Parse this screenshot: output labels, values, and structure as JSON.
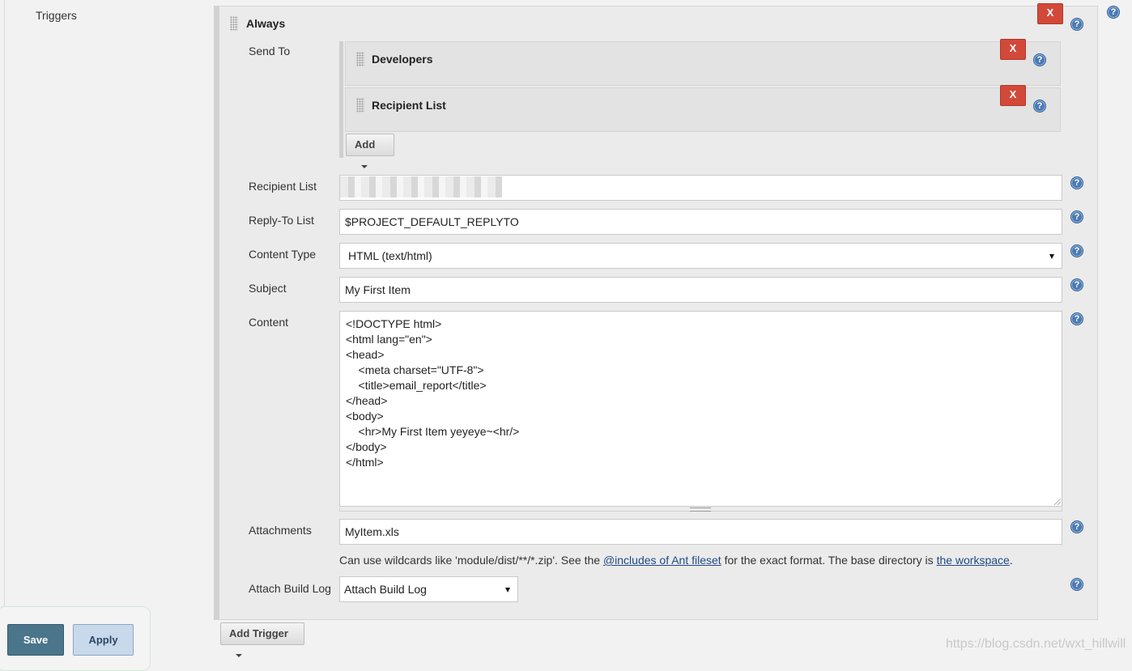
{
  "section": {
    "triggers_label": "Triggers"
  },
  "trigger": {
    "title": "Always",
    "remove_label": "X",
    "help_glyph": "?",
    "send_to": {
      "label": "Send To",
      "items": [
        {
          "title": "Developers",
          "remove_label": "X"
        },
        {
          "title": "Recipient List",
          "remove_label": "X"
        }
      ],
      "add_label": "Add"
    },
    "fields": {
      "recipient_list": {
        "label": "Recipient List",
        "value": ""
      },
      "reply_to": {
        "label": "Reply-To List",
        "value": "$PROJECT_DEFAULT_REPLYTO"
      },
      "content_type": {
        "label": "Content Type",
        "value": "HTML (text/html)"
      },
      "subject": {
        "label": "Subject",
        "value": "My First Item"
      },
      "content": {
        "label": "Content",
        "value": "<!DOCTYPE html>\n<html lang=\"en\">\n<head>\n    <meta charset=\"UTF-8\">\n    <title>email_report</title>\n</head>\n<body>\n    <hr>My First Item yeyeye~<hr/>\n</body>\n</html>"
      },
      "attachments": {
        "label": "Attachments",
        "value": "MyItem.xls"
      },
      "attach_build_log": {
        "label": "Attach Build Log",
        "value": "Attach Build Log"
      }
    },
    "hint": {
      "prefix": "Can use wildcards like 'module/dist/**/*.zip'. See the ",
      "link1": "@includes of Ant fileset",
      "middle": " for the exact format. The base directory is ",
      "link2": "the workspace",
      "suffix": "."
    }
  },
  "add_trigger_label": "Add Trigger",
  "footer": {
    "save_label": "Save",
    "apply_label": "Apply"
  },
  "watermark": "https://blog.csdn.net/wxt_hillwill",
  "colors": {
    "danger": "#d24939",
    "help": "#4a7ab5",
    "save": "#4b758b",
    "apply": "#c8d9ec",
    "link": "#204a87"
  },
  "icons": {
    "help": "question-circle-icon",
    "drag": "drag-handle-icon",
    "dropdown": "caret-down-icon"
  }
}
